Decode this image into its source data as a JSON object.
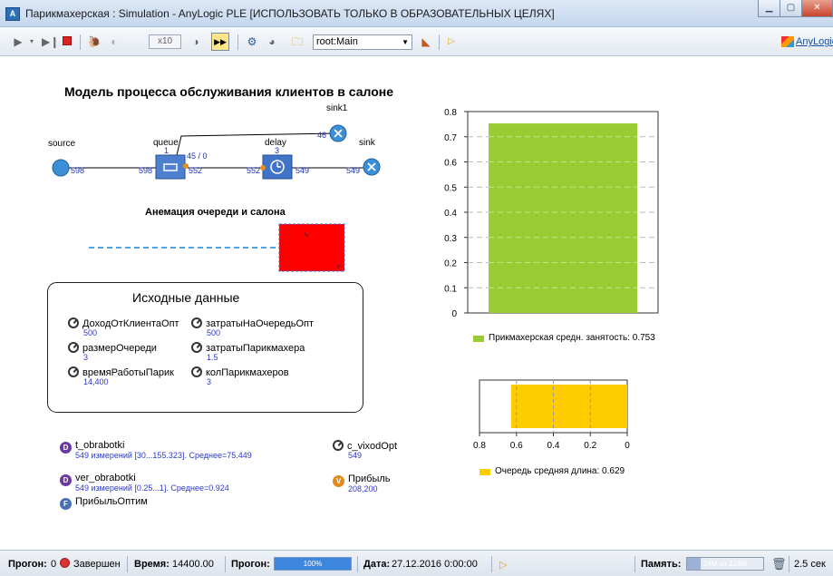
{
  "window": {
    "title": "Парикмахерская : Simulation - AnyLogic PLE [ИСПОЛЬЗОВАТЬ ТОЛЬКО В ОБРАЗОВАТЕЛЬНЫХ ЦЕЛЯХ]",
    "app_icon": "A"
  },
  "toolbar": {
    "speed": "x10",
    "combo_value": "root:Main",
    "brand": "AnyLogic"
  },
  "model": {
    "title": "Модель процесса обслуживания клиентов в салоне",
    "nodes": {
      "source": {
        "label": "source",
        "out": "598"
      },
      "queue": {
        "label": "queue",
        "in": "598",
        "size": "1",
        "capacity": "45 / 0",
        "out": "552"
      },
      "delay": {
        "label": "delay",
        "in": "552",
        "size": "3",
        "out": "549"
      },
      "sink": {
        "label": "sink",
        "in": "549"
      },
      "sink1": {
        "label": "sink1",
        "in": "46"
      }
    },
    "animation_title": "Анемация очереди и салона"
  },
  "inputs": {
    "title": "Исходные данные",
    "params": [
      {
        "name": "ДоходОтКлиентаОпт",
        "value": "500"
      },
      {
        "name": "затратыНаОчередьОпт",
        "value": "500"
      },
      {
        "name": "размерОчереди",
        "value": "3"
      },
      {
        "name": "затратыПарикмахера",
        "value": "1.5"
      },
      {
        "name": "времяРаботыПарик",
        "value": "14,400"
      },
      {
        "name": "колПарикмахеров",
        "value": "3"
      }
    ]
  },
  "stats": {
    "t_obrabotki": {
      "name": "t_obrabotki",
      "detail": "549 измерений [30...155.323]. Среднее=75.449"
    },
    "ver_obrabotki": {
      "name": "ver_obrabotki",
      "detail": "549 измерений [0.25...1]. Среднее=0.924"
    },
    "c_vixodOpt": {
      "name": "c_vixodOpt",
      "value": "549"
    },
    "pribyl": {
      "name": "Прибыль",
      "value": "208,200",
      "icon": "V"
    },
    "pribylOptim": {
      "name": "ПрибыльОптим",
      "icon": "F"
    }
  },
  "colors": {
    "busy": "#99cc33",
    "queue": "#ffcc00",
    "anim_box": "#ff0000"
  },
  "chart_data": [
    {
      "type": "bar",
      "categories": [
        ""
      ],
      "values": [
        0.753
      ],
      "ylim": [
        0,
        0.8
      ],
      "yticks": [
        "0",
        "0.1",
        "0.2",
        "0.3",
        "0.4",
        "0.5",
        "0.6",
        "0.7",
        "0.8"
      ],
      "legend": "Прикмахерская средн. занятость: 0.753",
      "grid": true
    },
    {
      "type": "bar",
      "orientation": "horizontal",
      "categories": [
        ""
      ],
      "values": [
        0.629
      ],
      "xlim": [
        0.8,
        0
      ],
      "xticks": [
        "0.8",
        "0.6",
        "0.4",
        "0.2",
        "0"
      ],
      "legend": "Очередь средняя длина: 0.629",
      "grid": true
    }
  ],
  "status": {
    "run_label": "Прогон:",
    "run_value": "0",
    "state": "Завершен",
    "time_label": "Время:",
    "time_value": "14400.00",
    "progress_label": "Прогон:",
    "progress_value": "100%",
    "date_label": "Дата:",
    "date_value": "27.12.2016 0:00:00",
    "memory_label": "Память:",
    "memory_value": "24M из 228M",
    "elapsed": "2.5 сек"
  }
}
